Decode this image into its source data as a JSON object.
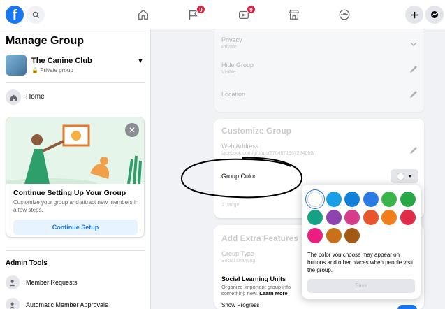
{
  "topbar": {
    "logo": "f",
    "notifications": {
      "pages_badge": "9",
      "watch_badge": "9"
    }
  },
  "sidebar": {
    "title": "Manage Group",
    "group": {
      "name": "The Canine Club",
      "privacy": "Private group"
    },
    "home_label": "Home",
    "setup_card": {
      "title": "Continue Setting Up Your Group",
      "description": "Customize your group and attract new members in a few steps.",
      "button": "Continue Setup"
    },
    "admin_tools": {
      "title": "Admin Tools",
      "items": [
        {
          "label": "Member Requests"
        },
        {
          "label": "Automatic Member Approvals"
        }
      ]
    }
  },
  "settings": {
    "privacy": {
      "label": "Privacy",
      "value": "Private"
    },
    "hide_group": {
      "label": "Hide Group",
      "value": "Visible"
    },
    "location": {
      "label": "Location"
    },
    "customize": {
      "title": "Customize Group",
      "web_address_label": "Web Address",
      "web_address_value": "facebook.com/groups/2704671967234060/",
      "group_color_label": "Group Color",
      "badges_value": "1 badge"
    },
    "extra": {
      "title": "Add Extra Features",
      "group_type_label": "Group Type",
      "group_type_value": "Social Learning",
      "social_learning_title": "Social Learning Units",
      "social_learning_desc": "Organize important group info",
      "social_learning_desc2": "something new.",
      "learn_more": "Learn More",
      "show_progress": "Show Progress"
    }
  },
  "color_picker": {
    "swatches": [
      "#ffffff",
      "#1a9fe6",
      "#1181d8",
      "#2b7be5",
      "#39b54a",
      "#28a745",
      "#16a085",
      "#8e44ad",
      "#d63c8a",
      "#e8552c",
      "#f07e1b",
      "#e02b4a",
      "#e91e80",
      "#c8711a",
      "#a25914"
    ],
    "note": "The color you choose may appear on buttons and other places when people visit the group.",
    "save": "Save"
  },
  "colors": {
    "accent": "#1877f2",
    "badge": "#e41e3f"
  }
}
